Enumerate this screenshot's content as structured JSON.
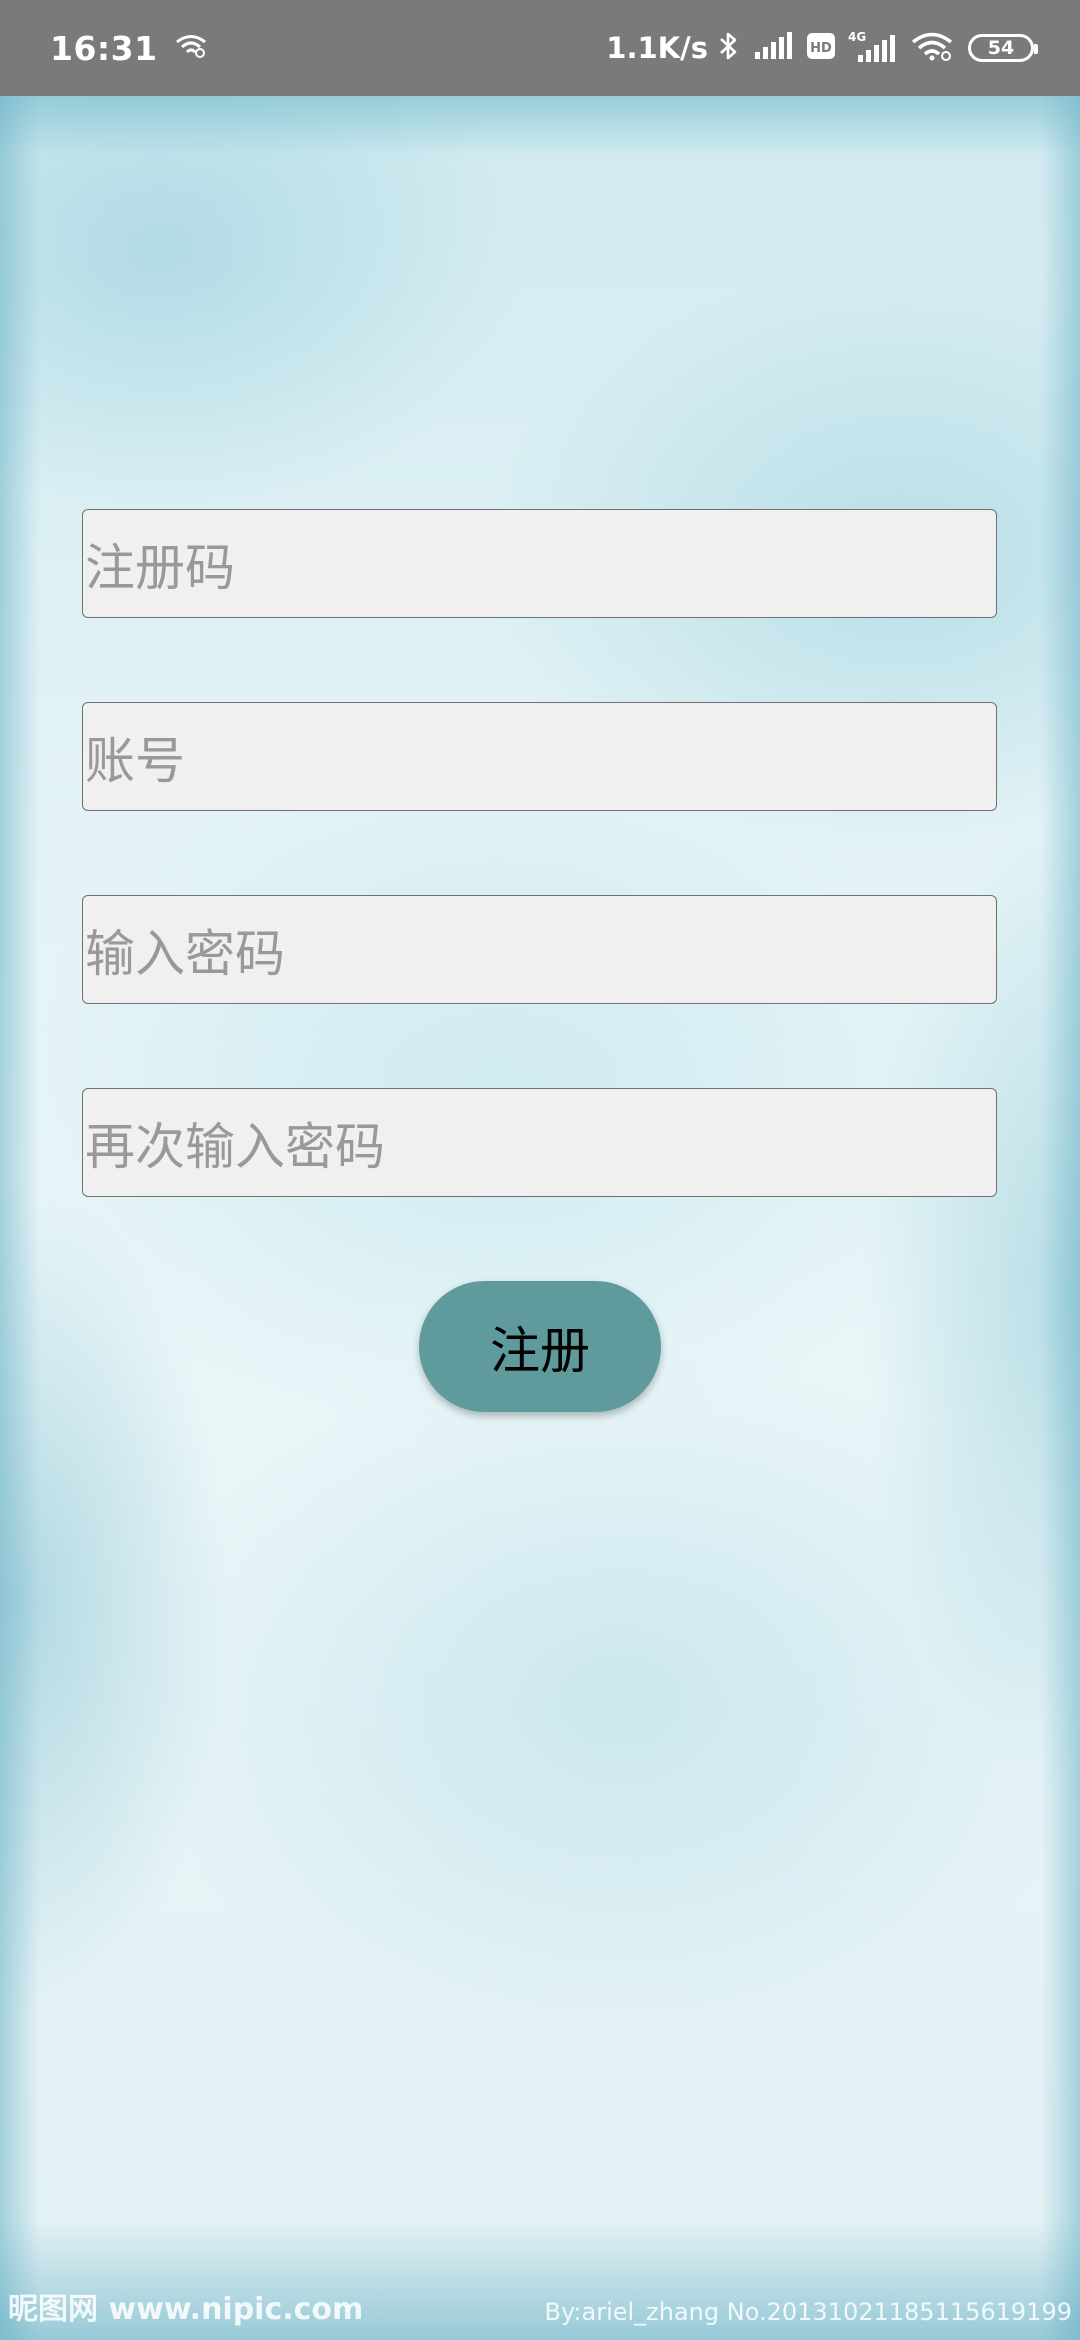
{
  "status_bar": {
    "time": "16:31",
    "net_speed": "1.1K/s",
    "battery": "54",
    "icons": [
      "wifi-hotspot-icon",
      "bluetooth-icon",
      "signal-icon",
      "hd-icon",
      "4g-signal-icon",
      "wifi-icon"
    ]
  },
  "form": {
    "registration_code_placeholder": "注册码",
    "account_placeholder": "账号",
    "password_placeholder": "输入密码",
    "confirm_password_placeholder": "再次输入密码",
    "register_label": "注册"
  },
  "watermark": {
    "left": "昵图网 www.nipic.com",
    "right": "By:ariel_zhang No.20131021185115619199"
  },
  "colors": {
    "button": "#5f9b9c",
    "field_bg": "#f0f0f0",
    "status_bar": "#7a7a7a"
  }
}
